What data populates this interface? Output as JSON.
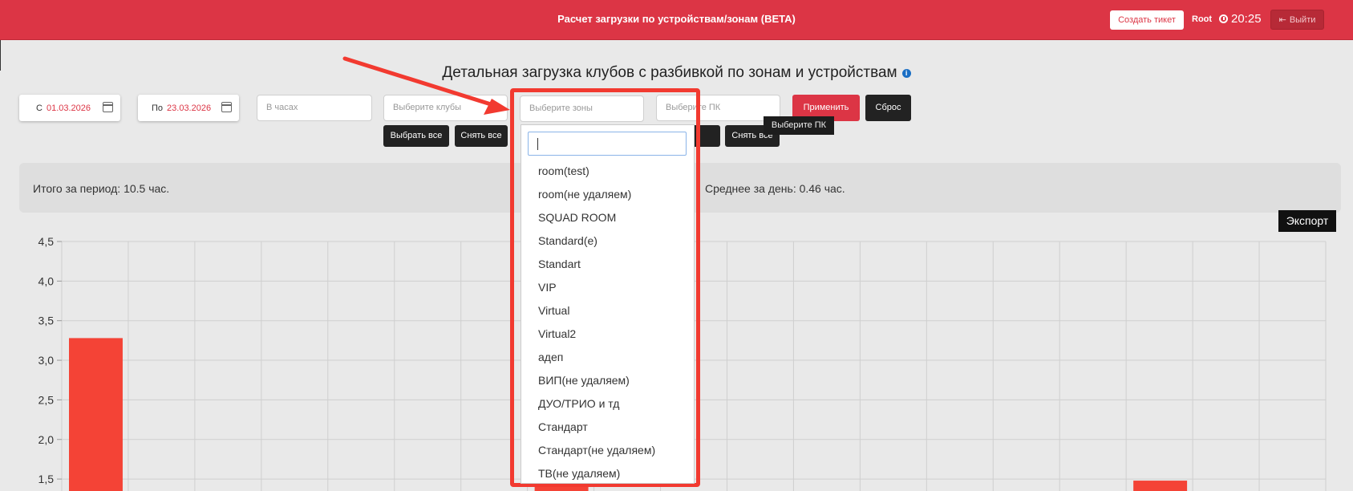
{
  "header": {
    "title": "Расчет загрузки по устройствам/зонам (BETA)",
    "create_ticket": "Создать тикет",
    "user": "Root",
    "time": "20:25",
    "logout": "Выйти"
  },
  "page": {
    "title": "Детальная загрузка клубов с разбивкой по зонам и устройствам"
  },
  "filters": {
    "date_from_label": "С",
    "date_from": "01.03.2026",
    "date_to_label": "По",
    "date_to": "23.03.2026",
    "hours_placeholder": "В часах",
    "clubs_placeholder": "Выберите клубы",
    "zones_placeholder": "Выберите зоны",
    "pc_placeholder": "Выберите ПК",
    "select_all": "Выбрать все",
    "deselect_all": "Снять все",
    "deselect_all_pc": "Снять все",
    "apply": "Применить",
    "reset": "Сброс",
    "tooltip": "Выберите ПК"
  },
  "summary": {
    "total": "Итого за период: 10.5 час.",
    "average": "Среднее за день: 0.46 час."
  },
  "export_label": "Экспорт",
  "zones_dropdown": {
    "items": [
      "room(test)",
      "room(не удаляем)",
      "SQUAD ROOM",
      "Standard(e)",
      "Standart",
      "VIP",
      "Virtual",
      "Virtual2",
      "адеп",
      "ВИП(не удаляем)",
      "ДУО/ТРИО и тд",
      "Стандарт",
      "Стандарт(не удаляем)",
      "ТВ(не удаляем)"
    ]
  },
  "colors": {
    "accent": "#dc3545",
    "bar": "#f44336",
    "highlight": "#f23a30"
  },
  "chart_data": {
    "type": "bar",
    "y_ticks": [
      "4,5",
      "4,0",
      "3,5",
      "3,0",
      "2,5",
      "2,0",
      "1,5"
    ],
    "ylim": [
      1.5,
      4.5
    ],
    "visible_range_bottom": 1.35,
    "columns": 19,
    "bars": [
      {
        "index": 0,
        "value": 3.28
      },
      {
        "index": 7,
        "value": 1.4
      },
      {
        "index": 16,
        "value": 1.48
      }
    ]
  }
}
